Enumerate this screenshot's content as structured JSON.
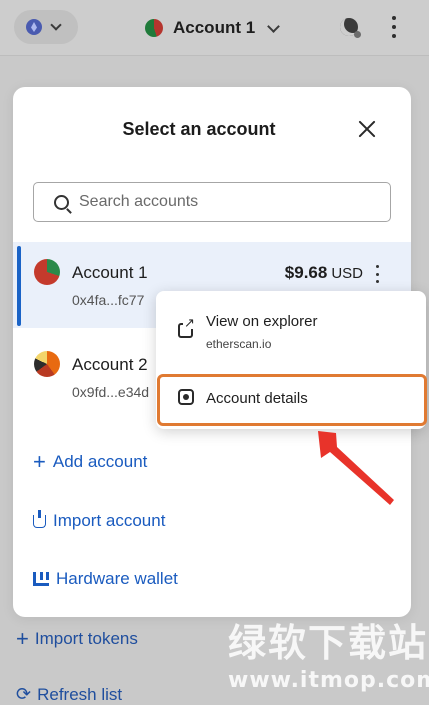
{
  "header": {
    "account_name": "Account 1"
  },
  "background": {
    "import_tokens": "Import tokens",
    "refresh_list": "Refresh list"
  },
  "modal": {
    "title": "Select an account",
    "search_placeholder": "Search accounts",
    "accounts": [
      {
        "name": "Account 1",
        "address": "0x4fa...fc77",
        "balance": "$9.68",
        "currency": "USD",
        "selected": true
      },
      {
        "name": "Account 2",
        "address": "0x9fd...e34d",
        "selected": false
      }
    ],
    "actions": {
      "add_account": "Add account",
      "import_account": "Import account",
      "hardware_wallet": "Hardware wallet"
    }
  },
  "popup": {
    "view_explorer": "View on explorer",
    "explorer_domain": "etherscan.io",
    "account_details": "Account details"
  },
  "annotation": {
    "highlight_color": "#e07a32",
    "arrow_color": "#e8332a"
  },
  "watermark": {
    "text": "绿软下载站",
    "url": "www.itmop.com"
  },
  "colors": {
    "accent": "#1a63c7",
    "selected_row_bg": "#eaf0fa"
  }
}
